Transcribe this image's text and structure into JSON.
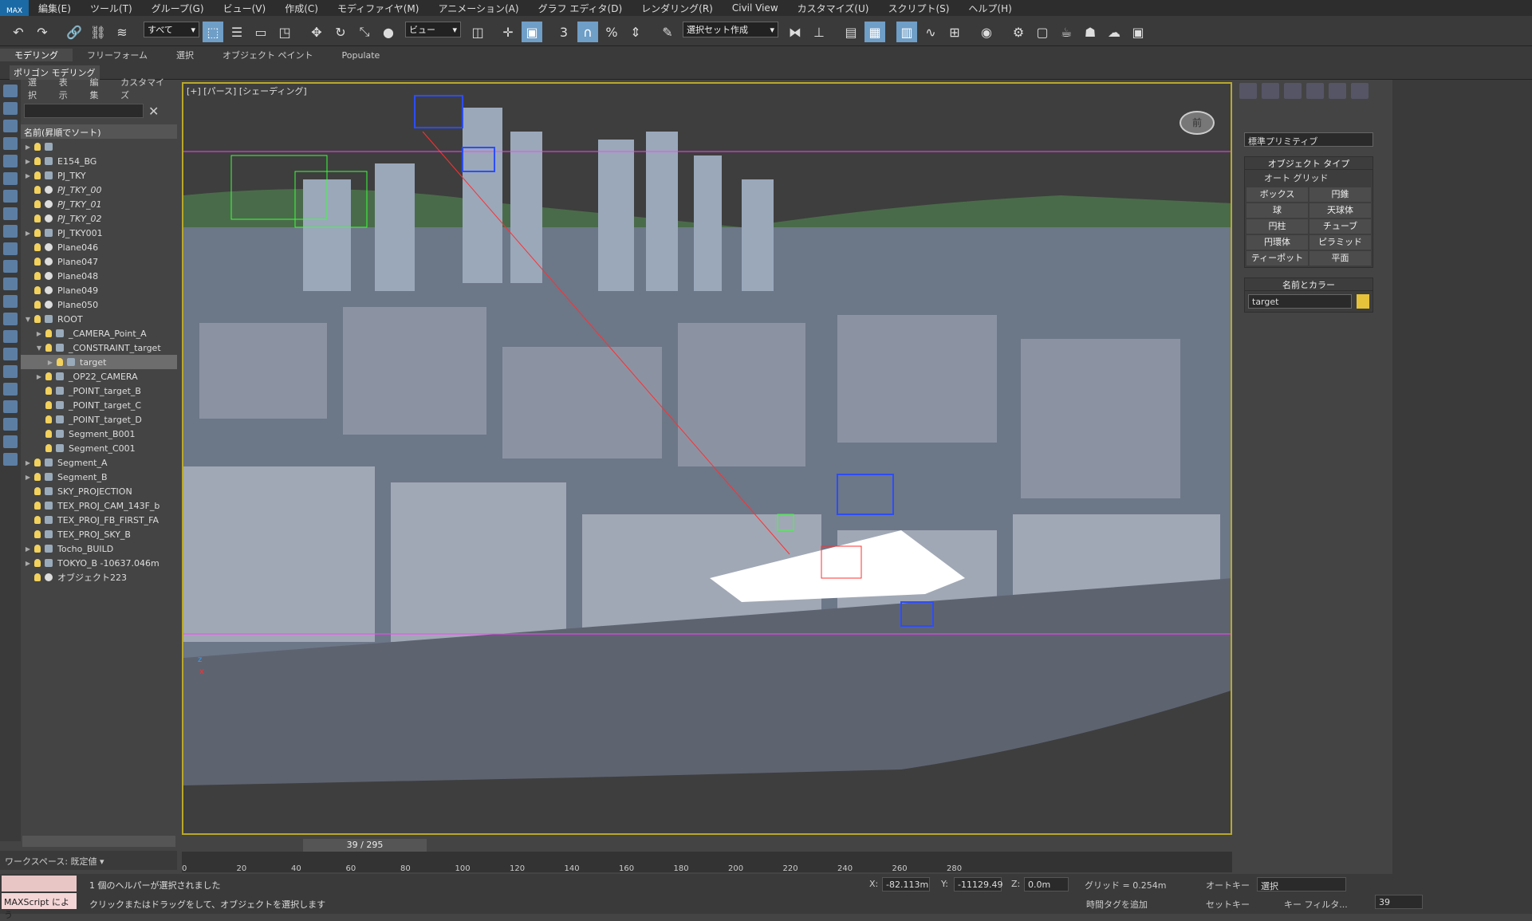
{
  "menubar": {
    "logo": "MAX",
    "items": [
      "編集(E)",
      "ツール(T)",
      "グループ(G)",
      "ビュー(V)",
      "作成(C)",
      "モディファイヤ(M)",
      "アニメーション(A)",
      "グラフ エディタ(D)",
      "レンダリング(R)",
      "Civil View",
      "カスタマイズ(U)",
      "スクリプト(S)",
      "ヘルプ(H)"
    ]
  },
  "toolbar": {
    "filter_value": "すべて",
    "coord_value": "ビュー",
    "selset_value": "選択セット作成"
  },
  "ribbon": {
    "tabs": [
      "モデリング",
      "フリーフォーム",
      "選択",
      "オブジェクト ペイント",
      "Populate"
    ],
    "sub": "ポリゴン モデリング"
  },
  "scene": {
    "tabs": [
      "選択",
      "表示",
      "編集",
      "カスタマイズ"
    ],
    "header": "名前(昇順でソート)",
    "rows": [
      {
        "label": "",
        "indent": 0,
        "icon": "bulb",
        "arrow": "▶"
      },
      {
        "label": "E154_BG",
        "indent": 0,
        "icon": "bulb",
        "arrow": "▶"
      },
      {
        "label": "PJ_TKY",
        "indent": 0,
        "icon": "bulb",
        "arrow": "▶"
      },
      {
        "label": "PJ_TKY_00",
        "indent": 0,
        "icon": "obj",
        "arrow": "",
        "italic": true
      },
      {
        "label": "PJ_TKY_01",
        "indent": 0,
        "icon": "obj",
        "arrow": "",
        "italic": true
      },
      {
        "label": "PJ_TKY_02",
        "indent": 0,
        "icon": "obj",
        "arrow": "",
        "italic": true
      },
      {
        "label": "PJ_TKY001",
        "indent": 0,
        "icon": "bulb",
        "arrow": "▶"
      },
      {
        "label": "Plane046",
        "indent": 0,
        "icon": "obj",
        "arrow": ""
      },
      {
        "label": "Plane047",
        "indent": 0,
        "icon": "obj",
        "arrow": ""
      },
      {
        "label": "Plane048",
        "indent": 0,
        "icon": "obj",
        "arrow": ""
      },
      {
        "label": "Plane049",
        "indent": 0,
        "icon": "obj",
        "arrow": ""
      },
      {
        "label": "Plane050",
        "indent": 0,
        "icon": "obj",
        "arrow": ""
      },
      {
        "label": "ROOT",
        "indent": 0,
        "icon": "bulb",
        "arrow": "▼"
      },
      {
        "label": "_CAMERA_Point_A",
        "indent": 1,
        "icon": "bulb",
        "arrow": "▶"
      },
      {
        "label": "_CONSTRAINT_target",
        "indent": 1,
        "icon": "bulb",
        "arrow": "▼"
      },
      {
        "label": "target",
        "indent": 2,
        "icon": "bulb",
        "arrow": "▶",
        "selected": true
      },
      {
        "label": "_OP22_CAMERA",
        "indent": 1,
        "icon": "bulb",
        "arrow": "▶"
      },
      {
        "label": "_POINT_target_B",
        "indent": 1,
        "icon": "bulb",
        "arrow": ""
      },
      {
        "label": "_POINT_target_C",
        "indent": 1,
        "icon": "bulb",
        "arrow": ""
      },
      {
        "label": "_POINT_target_D",
        "indent": 1,
        "icon": "bulb",
        "arrow": ""
      },
      {
        "label": "Segment_B001",
        "indent": 1,
        "icon": "bulb",
        "arrow": ""
      },
      {
        "label": "Segment_C001",
        "indent": 1,
        "icon": "bulb",
        "arrow": ""
      },
      {
        "label": "Segment_A",
        "indent": 0,
        "icon": "bulb",
        "arrow": "▶"
      },
      {
        "label": "Segment_B",
        "indent": 0,
        "icon": "bulb",
        "arrow": "▶"
      },
      {
        "label": "SKY_PROJECTION",
        "indent": 0,
        "icon": "bulb",
        "arrow": ""
      },
      {
        "label": "TEX_PROJ_CAM_143F_b",
        "indent": 0,
        "icon": "bulb",
        "arrow": ""
      },
      {
        "label": "TEX_PROJ_FB_FIRST_FA",
        "indent": 0,
        "icon": "bulb",
        "arrow": ""
      },
      {
        "label": "TEX_PROJ_SKY_B",
        "indent": 0,
        "icon": "bulb",
        "arrow": ""
      },
      {
        "label": "Tocho_BUILD",
        "indent": 0,
        "icon": "bulb",
        "arrow": "▶"
      },
      {
        "label": "TOKYO_B -10637.046m",
        "indent": 0,
        "icon": "bulb",
        "arrow": "▶"
      },
      {
        "label": "オブジェクト223",
        "indent": 0,
        "icon": "obj",
        "arrow": ""
      }
    ]
  },
  "workspace": "ワークスペース: 既定値",
  "viewport": {
    "label": "[+] [パース] [シェーディング]",
    "viewcube": "前"
  },
  "time": {
    "slider": "39 / 295",
    "ticks": [
      "0",
      "20",
      "40",
      "60",
      "80",
      "100",
      "120",
      "140",
      "160",
      "180",
      "200",
      "220",
      "240",
      "260",
      "280"
    ]
  },
  "status": {
    "maxscript": "MAXScript によう",
    "msg1": "1 個のヘルパーが選択されました",
    "msg2": "クリックまたはドラッグをして、オブジェクトを選択します",
    "x": "-82.113m",
    "y": "-11129.49",
    "z": "0.0m",
    "grid": "グリッド = 0.254m",
    "addtag": "時間タグを追加",
    "autokey": "オートキー",
    "setkey": "セットキー",
    "keyfilter": "キー フィルタ...",
    "selset": "選択",
    "frame": "39"
  },
  "cmdpanel": {
    "dropdown": "標準プリミティブ",
    "objtype": "オブジェクト タイプ",
    "autogrid": "オート グリッド",
    "buttons": [
      "ボックス",
      "円錐",
      "球",
      "天球体",
      "円柱",
      "チューブ",
      "円環体",
      "ピラミッド",
      "ティーポット",
      "平面"
    ],
    "namecolor": "名前とカラー",
    "name": "target",
    "swatch": "#e6c23a"
  }
}
